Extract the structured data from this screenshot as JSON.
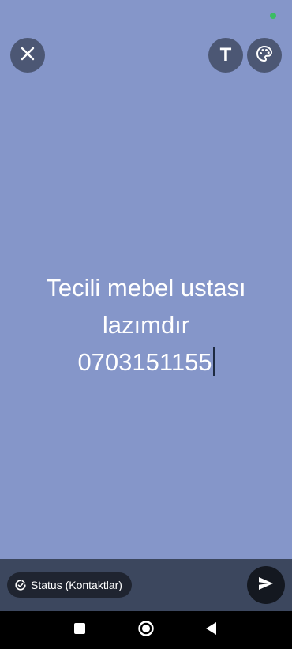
{
  "colors": {
    "background": "#8596c9",
    "bottom_bar": "#3c475e",
    "chip": "#1f2430",
    "send": "#141820"
  },
  "top_controls": {
    "close_icon": "close-icon",
    "text_tool_label": "T",
    "palette_icon": "palette-icon"
  },
  "status": {
    "lines": [
      "Tecili mebel ustası",
      "lazımdır",
      "0703151155"
    ]
  },
  "bottom_bar": {
    "audience_label": "Status (Kontaktlar)",
    "audience_icon": "status-icon",
    "send_icon": "send-icon"
  },
  "system_nav": {
    "recents_icon": "square-icon",
    "home_icon": "circle-icon",
    "back_icon": "triangle-back-icon"
  }
}
